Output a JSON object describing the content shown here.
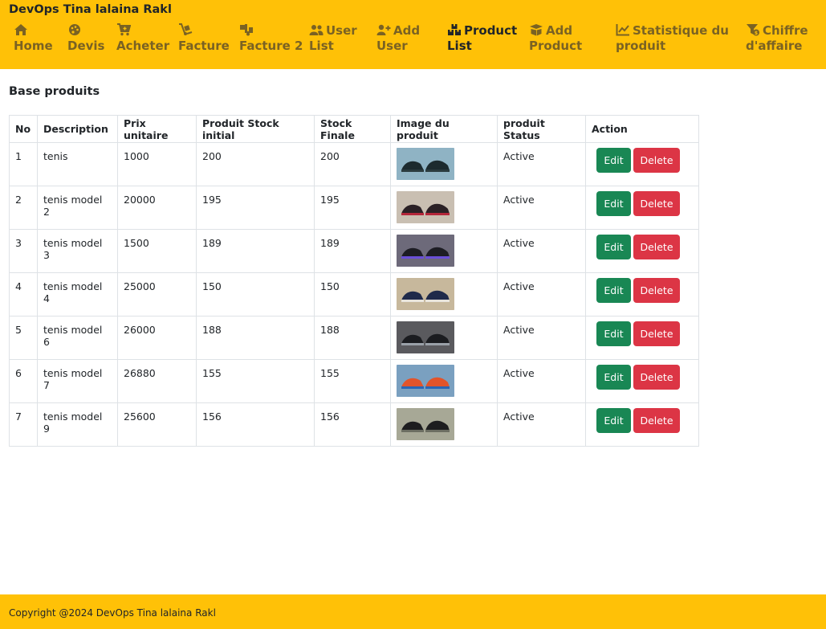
{
  "navbar": {
    "brand": "DevOps Tina lalaina Rakl",
    "items": [
      {
        "icon": "home-icon",
        "label1": "Home",
        "label2": ""
      },
      {
        "icon": "palette-icon",
        "label1": "Devis",
        "label2": ""
      },
      {
        "icon": "cart-icon",
        "label1": "Acheter",
        "label2": ""
      },
      {
        "icon": "dolly-icon",
        "label1": "Facture",
        "label2": ""
      },
      {
        "icon": "truck-loading-icon",
        "label1": "Facture 2",
        "label2": ""
      },
      {
        "icon": "users-icon",
        "label1": "User",
        "label2": "List"
      },
      {
        "icon": "user-plus-icon",
        "label1": "Add",
        "label2": "User"
      },
      {
        "icon": "boxes-icon",
        "label1": "Product",
        "label2": "List"
      },
      {
        "icon": "box-open-icon",
        "label1": "Add",
        "label2": "Product"
      },
      {
        "icon": "chart-line-icon",
        "label1": "Statistique du",
        "label2": "produit"
      },
      {
        "icon": "funnel-dollar-icon",
        "label1": "Chiffre",
        "label2": "d'affaire"
      }
    ],
    "active_index": 7
  },
  "page": {
    "title": "Base produits"
  },
  "table": {
    "headers": [
      "No",
      "Description",
      "Prix unitaire",
      "Produit Stock initial",
      "Stock Finale",
      "Image du produit",
      "produit Status",
      "Action"
    ],
    "rows": [
      {
        "no": "1",
        "description": "tenis",
        "prix": "1000",
        "stock_initial": "200",
        "stock_finale": "200",
        "status": "Active"
      },
      {
        "no": "2",
        "description": "tenis model 2",
        "prix": "20000",
        "stock_initial": "195",
        "stock_finale": "195",
        "status": "Active"
      },
      {
        "no": "3",
        "description": "tenis model 3",
        "prix": "1500",
        "stock_initial": "189",
        "stock_finale": "189",
        "status": "Active"
      },
      {
        "no": "4",
        "description": "tenis model 4",
        "prix": "25000",
        "stock_initial": "150",
        "stock_finale": "150",
        "status": "Active"
      },
      {
        "no": "5",
        "description": "tenis model 6",
        "prix": "26000",
        "stock_initial": "188",
        "stock_finale": "188",
        "status": "Active"
      },
      {
        "no": "6",
        "description": "tenis model 7",
        "prix": "26880",
        "stock_initial": "155",
        "stock_finale": "155",
        "status": "Active"
      },
      {
        "no": "7",
        "description": "tenis model 9",
        "prix": "25600",
        "stock_initial": "156",
        "stock_finale": "156",
        "status": "Active"
      }
    ],
    "edit_label": "Edit",
    "delete_label": "Delete"
  },
  "footer": {
    "text": "Copyright @2024 DevOps Tina lalaina Rakl"
  },
  "colors": {
    "navbar_bg": "#ffc107",
    "nav_text": "#7a6223",
    "edit": "#198754",
    "delete": "#dc3545"
  }
}
